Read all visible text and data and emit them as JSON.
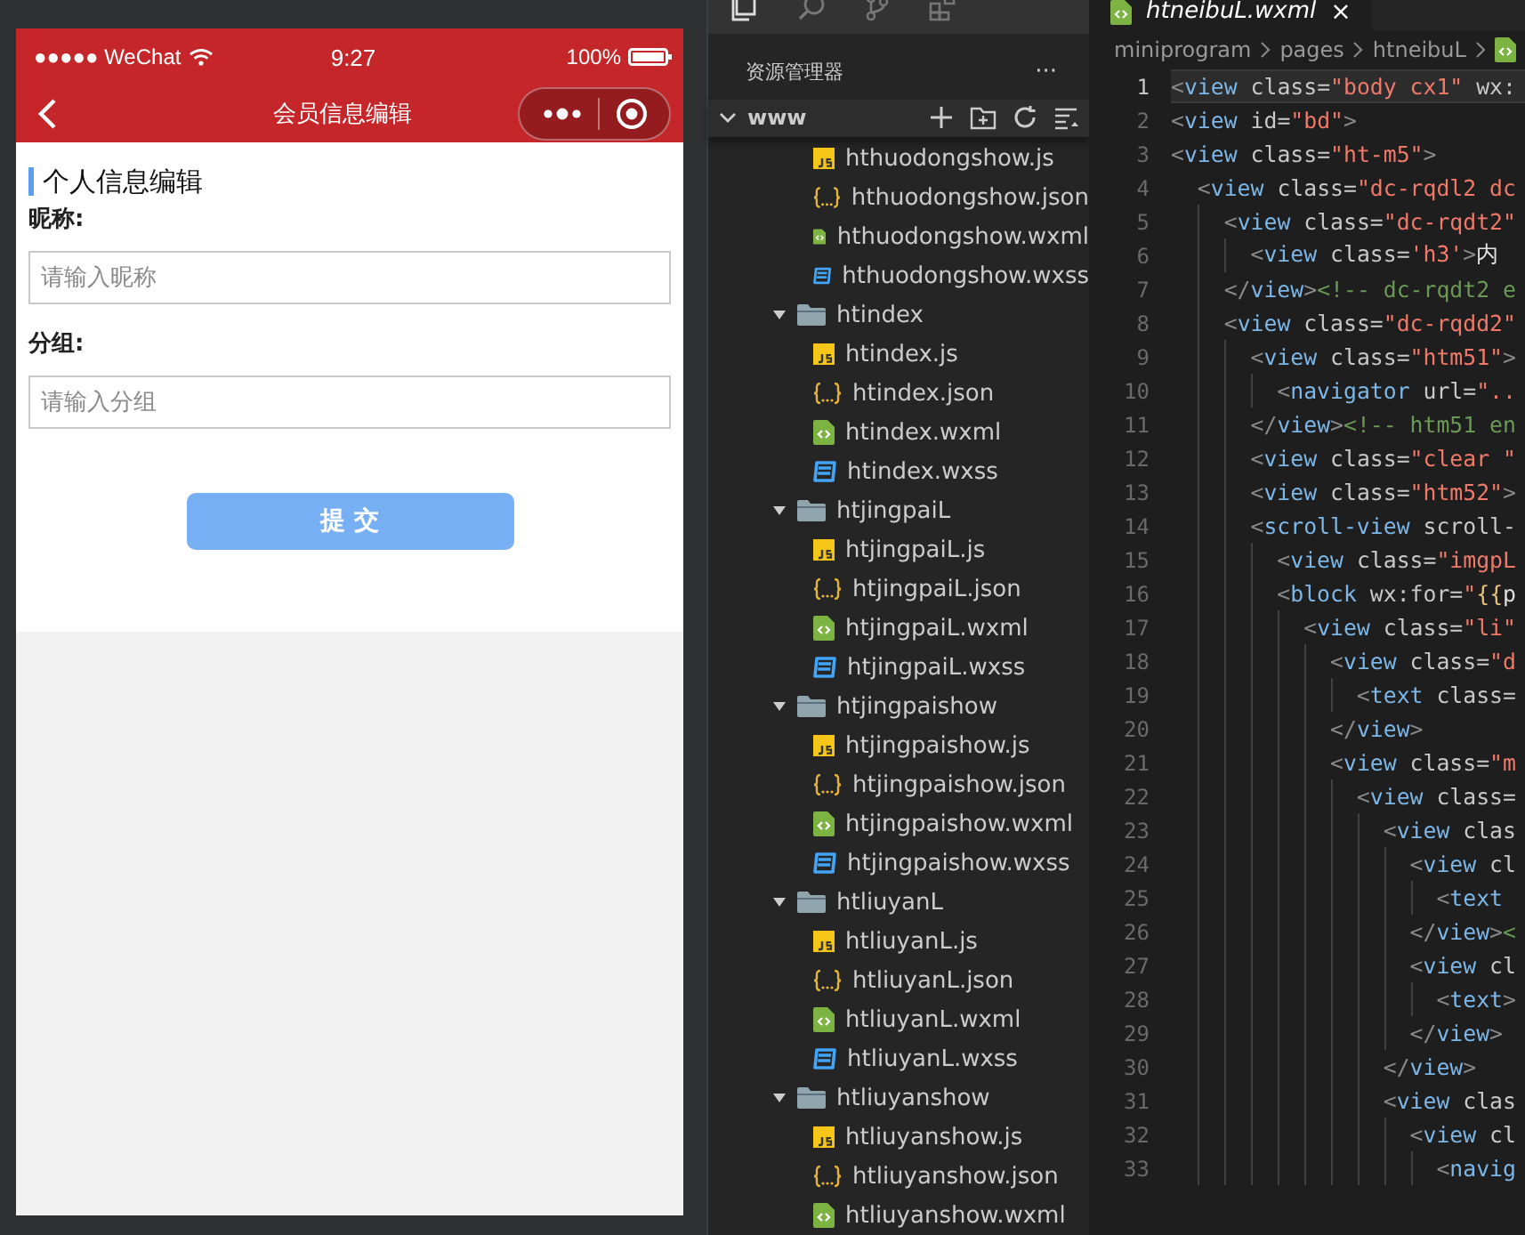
{
  "simulator": {
    "status_bar": {
      "carrier": "●●●●● WeChat",
      "time": "9:27",
      "battery": "100%"
    },
    "nav_bar": {
      "title": "会员信息编辑"
    },
    "form": {
      "section_title": "个人信息编辑",
      "fields": [
        {
          "label": "昵称:",
          "placeholder": "请输入昵称"
        },
        {
          "label": "分组:",
          "placeholder": "请输入分组"
        }
      ],
      "submit": "提 交"
    }
  },
  "explorer": {
    "title": "资源管理器",
    "more": "···",
    "root": "www",
    "root_expanded": true,
    "tree": [
      {
        "kind": "hidden",
        "children": [
          {
            "kind": "js",
            "name": "hthuodongshow.js"
          },
          {
            "kind": "json",
            "name": "hthuodongshow.json"
          },
          {
            "kind": "wxml",
            "name": "hthuodongshow.wxml"
          },
          {
            "kind": "wxss",
            "name": "hthuodongshow.wxss"
          }
        ]
      },
      {
        "kind": "folder",
        "name": "htindex",
        "expanded": true,
        "children": [
          {
            "kind": "js",
            "name": "htindex.js"
          },
          {
            "kind": "json",
            "name": "htindex.json"
          },
          {
            "kind": "wxml",
            "name": "htindex.wxml"
          },
          {
            "kind": "wxss",
            "name": "htindex.wxss"
          }
        ]
      },
      {
        "kind": "folder",
        "name": "htjingpaiL",
        "expanded": true,
        "children": [
          {
            "kind": "js",
            "name": "htjingpaiL.js"
          },
          {
            "kind": "json",
            "name": "htjingpaiL.json"
          },
          {
            "kind": "wxml",
            "name": "htjingpaiL.wxml"
          },
          {
            "kind": "wxss",
            "name": "htjingpaiL.wxss"
          }
        ]
      },
      {
        "kind": "folder",
        "name": "htjingpaishow",
        "expanded": true,
        "children": [
          {
            "kind": "js",
            "name": "htjingpaishow.js"
          },
          {
            "kind": "json",
            "name": "htjingpaishow.json"
          },
          {
            "kind": "wxml",
            "name": "htjingpaishow.wxml"
          },
          {
            "kind": "wxss",
            "name": "htjingpaishow.wxss"
          }
        ]
      },
      {
        "kind": "folder",
        "name": "htliuyanL",
        "expanded": true,
        "children": [
          {
            "kind": "js",
            "name": "htliuyanL.js"
          },
          {
            "kind": "json",
            "name": "htliuyanL.json"
          },
          {
            "kind": "wxml",
            "name": "htliuyanL.wxml"
          },
          {
            "kind": "wxss",
            "name": "htliuyanL.wxss"
          }
        ]
      },
      {
        "kind": "folder",
        "name": "htliuyanshow",
        "expanded": true,
        "children": [
          {
            "kind": "js",
            "name": "htliuyanshow.js"
          },
          {
            "kind": "json",
            "name": "htliuyanshow.json"
          },
          {
            "kind": "wxml",
            "name": "htliuyanshow.wxml"
          }
        ]
      }
    ]
  },
  "editor": {
    "tab": {
      "title": "htneibuL.wxml",
      "close": "×",
      "selected": true
    },
    "breadcrumb": [
      "miniprogram",
      "pages",
      "htneibuL"
    ],
    "lines": [
      {
        "number": "1",
        "current": true,
        "code": [
          {
            "kind": "p",
            "t": "<"
          },
          {
            "kind": "tag",
            "t": "view"
          },
          {
            "kind": "attr",
            "t": " class="
          },
          {
            "kind": "str",
            "t": "\"body cx1\""
          },
          {
            "kind": "attr",
            "t": " wx:"
          }
        ]
      },
      {
        "number": "2",
        "current": false,
        "code": [
          {
            "kind": "p",
            "t": "<"
          },
          {
            "kind": "tag",
            "t": "view"
          },
          {
            "kind": "attr",
            "t": " id="
          },
          {
            "kind": "str",
            "t": "\"bd\""
          },
          {
            "kind": "p",
            "t": ">"
          }
        ]
      },
      {
        "number": "3",
        "current": false,
        "code": [
          {
            "kind": "p",
            "t": "<"
          },
          {
            "kind": "tag",
            "t": "view"
          },
          {
            "kind": "attr",
            "t": " class="
          },
          {
            "kind": "str",
            "t": "\"ht-m5\""
          },
          {
            "kind": "p",
            "t": ">"
          }
        ]
      },
      {
        "number": "4",
        "current": false,
        "code": [
          {
            "kind": "p",
            "t": "  <"
          },
          {
            "kind": "tag",
            "t": "view"
          },
          {
            "kind": "attr",
            "t": " class="
          },
          {
            "kind": "str",
            "t": "\"dc-rqdl2 dc"
          }
        ]
      },
      {
        "number": "5",
        "current": false,
        "code": [
          {
            "kind": "p",
            "t": "    <"
          },
          {
            "kind": "tag",
            "t": "view"
          },
          {
            "kind": "attr",
            "t": " class="
          },
          {
            "kind": "str",
            "t": "\"dc-rqdt2\""
          }
        ]
      },
      {
        "number": "6",
        "current": false,
        "code": [
          {
            "kind": "p",
            "t": "      <"
          },
          {
            "kind": "tag",
            "t": "view"
          },
          {
            "kind": "attr",
            "t": " class="
          },
          {
            "kind": "str",
            "t": "'h3'"
          },
          {
            "kind": "p",
            "t": ">"
          },
          {
            "kind": "text",
            "t": "内"
          }
        ]
      },
      {
        "number": "7",
        "current": false,
        "code": [
          {
            "kind": "p",
            "t": "    </"
          },
          {
            "kind": "tag",
            "t": "view"
          },
          {
            "kind": "p",
            "t": ">"
          },
          {
            "kind": "comment",
            "t": "<!-- dc-rqdt2 e"
          }
        ]
      },
      {
        "number": "8",
        "current": false,
        "code": [
          {
            "kind": "p",
            "t": "    <"
          },
          {
            "kind": "tag",
            "t": "view"
          },
          {
            "kind": "attr",
            "t": " class="
          },
          {
            "kind": "str",
            "t": "\"dc-rqdd2\""
          }
        ]
      },
      {
        "number": "9",
        "current": false,
        "code": [
          {
            "kind": "p",
            "t": "      <"
          },
          {
            "kind": "tag",
            "t": "view"
          },
          {
            "kind": "attr",
            "t": " class="
          },
          {
            "kind": "str",
            "t": "\"htm51\""
          },
          {
            "kind": "p",
            "t": ">"
          }
        ]
      },
      {
        "number": "10",
        "current": false,
        "code": [
          {
            "kind": "p",
            "t": "        <"
          },
          {
            "kind": "tag",
            "t": "navigator"
          },
          {
            "kind": "attr",
            "t": " url="
          },
          {
            "kind": "str",
            "t": "\".."
          }
        ]
      },
      {
        "number": "11",
        "current": false,
        "code": [
          {
            "kind": "p",
            "t": "      </"
          },
          {
            "kind": "tag",
            "t": "view"
          },
          {
            "kind": "p",
            "t": ">"
          },
          {
            "kind": "comment",
            "t": "<!-- htm51 en"
          }
        ]
      },
      {
        "number": "12",
        "current": false,
        "code": [
          {
            "kind": "p",
            "t": "      <"
          },
          {
            "kind": "tag",
            "t": "view"
          },
          {
            "kind": "attr",
            "t": " class="
          },
          {
            "kind": "str",
            "t": "\"clear \""
          }
        ]
      },
      {
        "number": "13",
        "current": false,
        "code": [
          {
            "kind": "p",
            "t": "      <"
          },
          {
            "kind": "tag",
            "t": "view"
          },
          {
            "kind": "attr",
            "t": " class="
          },
          {
            "kind": "str",
            "t": "\"htm52\""
          },
          {
            "kind": "p",
            "t": ">"
          }
        ]
      },
      {
        "number": "14",
        "current": false,
        "code": [
          {
            "kind": "p",
            "t": "      <"
          },
          {
            "kind": "tag",
            "t": "scroll-view"
          },
          {
            "kind": "attr",
            "t": " scroll-"
          }
        ]
      },
      {
        "number": "15",
        "current": false,
        "code": [
          {
            "kind": "p",
            "t": "        <"
          },
          {
            "kind": "tag",
            "t": "view"
          },
          {
            "kind": "attr",
            "t": " class="
          },
          {
            "kind": "str",
            "t": "\"imgpL"
          }
        ]
      },
      {
        "number": "16",
        "current": false,
        "code": [
          {
            "kind": "p",
            "t": "        <"
          },
          {
            "kind": "tag",
            "t": "block"
          },
          {
            "kind": "attr",
            "t": " wx:for="
          },
          {
            "kind": "str",
            "t": "\""
          },
          {
            "kind": "brace",
            "t": "{{"
          },
          {
            "kind": "text",
            "t": "p"
          }
        ]
      },
      {
        "number": "17",
        "current": false,
        "code": [
          {
            "kind": "p",
            "t": "          <"
          },
          {
            "kind": "tag",
            "t": "view"
          },
          {
            "kind": "attr",
            "t": " class="
          },
          {
            "kind": "str",
            "t": "\"li\""
          }
        ]
      },
      {
        "number": "18",
        "current": false,
        "code": [
          {
            "kind": "p",
            "t": "            <"
          },
          {
            "kind": "tag",
            "t": "view"
          },
          {
            "kind": "attr",
            "t": " class="
          },
          {
            "kind": "str",
            "t": "\"d"
          }
        ]
      },
      {
        "number": "19",
        "current": false,
        "code": [
          {
            "kind": "p",
            "t": "              <"
          },
          {
            "kind": "tag",
            "t": "text"
          },
          {
            "kind": "attr",
            "t": " class="
          }
        ]
      },
      {
        "number": "20",
        "current": false,
        "code": [
          {
            "kind": "p",
            "t": "            </"
          },
          {
            "kind": "tag",
            "t": "view"
          },
          {
            "kind": "p",
            "t": ">"
          }
        ]
      },
      {
        "number": "21",
        "current": false,
        "code": [
          {
            "kind": "p",
            "t": "            <"
          },
          {
            "kind": "tag",
            "t": "view"
          },
          {
            "kind": "attr",
            "t": " class="
          },
          {
            "kind": "str",
            "t": "\"m"
          }
        ]
      },
      {
        "number": "22",
        "current": false,
        "code": [
          {
            "kind": "p",
            "t": "              <"
          },
          {
            "kind": "tag",
            "t": "view"
          },
          {
            "kind": "attr",
            "t": " class="
          }
        ]
      },
      {
        "number": "23",
        "current": false,
        "code": [
          {
            "kind": "p",
            "t": "                <"
          },
          {
            "kind": "tag",
            "t": "view"
          },
          {
            "kind": "attr",
            "t": " clas"
          }
        ]
      },
      {
        "number": "24",
        "current": false,
        "code": [
          {
            "kind": "p",
            "t": "                  <"
          },
          {
            "kind": "tag",
            "t": "view"
          },
          {
            "kind": "attr",
            "t": " cl"
          }
        ]
      },
      {
        "number": "25",
        "current": false,
        "code": [
          {
            "kind": "p",
            "t": "                    <"
          },
          {
            "kind": "tag",
            "t": "text"
          }
        ]
      },
      {
        "number": "26",
        "current": false,
        "code": [
          {
            "kind": "p",
            "t": "                  </"
          },
          {
            "kind": "tag",
            "t": "view"
          },
          {
            "kind": "p",
            "t": ">"
          },
          {
            "kind": "comment",
            "t": "<"
          }
        ]
      },
      {
        "number": "27",
        "current": false,
        "code": [
          {
            "kind": "p",
            "t": "                  <"
          },
          {
            "kind": "tag",
            "t": "view"
          },
          {
            "kind": "attr",
            "t": " cl"
          }
        ]
      },
      {
        "number": "28",
        "current": false,
        "code": [
          {
            "kind": "p",
            "t": "                    <"
          },
          {
            "kind": "tag",
            "t": "text"
          },
          {
            "kind": "p",
            "t": ">"
          }
        ]
      },
      {
        "number": "29",
        "current": false,
        "code": [
          {
            "kind": "p",
            "t": "                  </"
          },
          {
            "kind": "tag",
            "t": "view"
          },
          {
            "kind": "p",
            "t": ">"
          }
        ]
      },
      {
        "number": "30",
        "current": false,
        "code": [
          {
            "kind": "p",
            "t": "                </"
          },
          {
            "kind": "tag",
            "t": "view"
          },
          {
            "kind": "p",
            "t": ">"
          }
        ]
      },
      {
        "number": "31",
        "current": false,
        "code": [
          {
            "kind": "p",
            "t": "                <"
          },
          {
            "kind": "tag",
            "t": "view"
          },
          {
            "kind": "attr",
            "t": " clas"
          }
        ]
      },
      {
        "number": "32",
        "current": false,
        "code": [
          {
            "kind": "p",
            "t": "                  <"
          },
          {
            "kind": "tag",
            "t": "view"
          },
          {
            "kind": "attr",
            "t": " cl"
          }
        ]
      },
      {
        "number": "33",
        "current": false,
        "code": [
          {
            "kind": "p",
            "t": "                    <"
          },
          {
            "kind": "tag",
            "t": "navig"
          }
        ]
      }
    ]
  }
}
